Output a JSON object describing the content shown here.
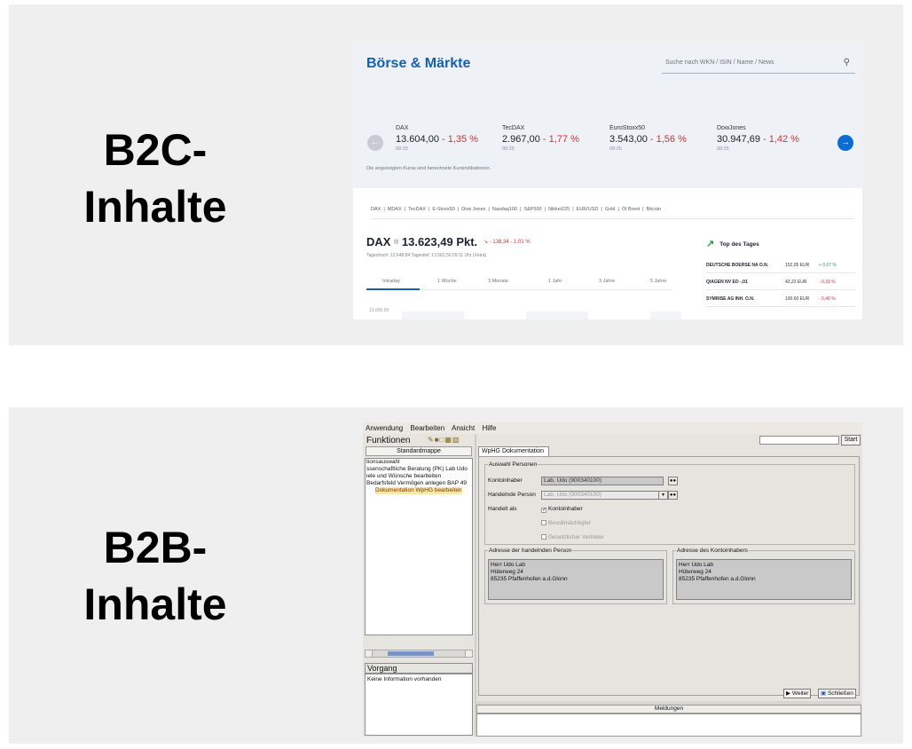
{
  "labels": {
    "b2c_line1": "B2C-",
    "b2c_line2": "Inhalte",
    "b2b_line1": "B2B-",
    "b2b_line2": "Inhalte"
  },
  "b2c": {
    "title": "Börse & Märkte",
    "search_placeholder": "Suche nach WKN / ISIN / Name / News",
    "quotes": [
      {
        "name": "DAX",
        "value": "13.604,00",
        "change": " - 1,35 %",
        "time": "09:25"
      },
      {
        "name": "TecDAX",
        "value": "2.967,00",
        "change": " - 1,77 %",
        "time": "09:25"
      },
      {
        "name": "EuroStoxx50",
        "value": "3.543,00",
        "change": " - 1,56 %",
        "time": "09:25"
      },
      {
        "name": "DowJones",
        "value": "30.947,69",
        "change": " - 1,42 %",
        "time": "09:25"
      }
    ],
    "disclaimer": "Die angezeigten Kurse sind berechnete Kursindikationen.",
    "index_tabs": [
      "DAX",
      "MDAX",
      "TecDAX",
      "E-Stoxx50",
      "Dow Jones",
      "Nasdaq100",
      "S&P500",
      "Nikkei225",
      "EUR/USD",
      "Gold",
      "Öl Brent",
      "Bitcoin"
    ],
    "index_name": "DAX",
    "index_value": "13.623,49 Pkt.",
    "index_change": "- 138,34  - 1,01 %",
    "index_meta": "Tageshoch: 13.648,84    Tagestief: 13.562,50    09:11 Uhr (Xetra)",
    "ranges": [
      "Intraday",
      "1 Woche",
      "3 Monate",
      "1 Jahr",
      "3 Jahre",
      "5 Jahre"
    ],
    "chart_axis_label": "13.600,00",
    "top_title": "Top des Tages",
    "top_items": [
      {
        "name": "DEUTSCHE BOERSE NA O.N.",
        "price": "152,05 EUR",
        "change": "+ 0,07 %",
        "up": true
      },
      {
        "name": "QIAGEN NV EO -,01",
        "price": "42,22 EUR",
        "change": "- 0,33 %",
        "up": false
      },
      {
        "name": "SYMRISE AG INH. O.N.",
        "price": "100,60 EUR",
        "change": "- 0,40 %",
        "up": false
      }
    ],
    "colors": {
      "brand": "#1660b0",
      "negative": "#d32f2f",
      "positive": "#2c9a4b"
    }
  },
  "b2b": {
    "menu": [
      "Anwendung",
      "Bearbeiten",
      "Ansicht",
      "Hilfe"
    ],
    "functions_title": "Funktionen",
    "standardmappe": "Standardmappe",
    "tree": [
      "tionsauswahl",
      "ssenschaftliche Beratung (PK) Lab Udo",
      "iele und Wünsche bearbeiten",
      "Bedarfsfeld Vermögen anlegen BAP 49"
    ],
    "tree_selected": "Dokumentation WpHG bearbeiten",
    "vorgang_title": "Vorgang",
    "vorgang_text": "Keine Information vorhanden",
    "start_button": "Start",
    "doc_tab": "WpHG Dokumentation",
    "group_persons": "Auswahl Personen",
    "kontoinhaber_label": "Kontoinhaber",
    "kontoinhaber_value": "Lab, Udo (900340100)",
    "handelnde_label": "Handelnde Person",
    "handelnde_value": "Lab, Udo (900340100)",
    "handelt_als_label": "Handelt als",
    "checkboxes": [
      {
        "label": "Kontoinhaber",
        "checked": true,
        "disabled": false
      },
      {
        "label": "Bevollmächtigter",
        "checked": false,
        "disabled": true
      },
      {
        "label": "Gesetzlicher Vertreter",
        "checked": false,
        "disabled": true
      }
    ],
    "addr_handelnde_title": "Adresse der handelnden Person",
    "addr_inhaber_title": "Adresse des Kontoinhabers",
    "address_lines": [
      "Herr Udo Lab",
      "Hüterweg 24",
      "85235 Pfaffenhofen a.d.Glonn"
    ],
    "weiter_button": "Weiter",
    "schliessen_button": "Schließen",
    "meldungen": "Meldungen"
  }
}
